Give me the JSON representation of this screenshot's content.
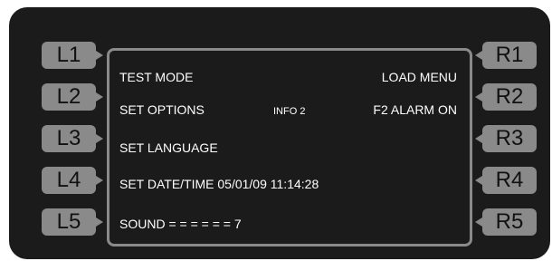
{
  "left_keys": [
    "L1",
    "L2",
    "L3",
    "L4",
    "L5"
  ],
  "right_keys": [
    "R1",
    "R2",
    "R3",
    "R4",
    "R5"
  ],
  "screen": {
    "left_labels": [
      "TEST MODE",
      "SET OPTIONS",
      "SET LANGUAGE",
      "SET DATE/TIME  05/01/09  11:14:28",
      "SOUND = = = = = = 7"
    ],
    "right_labels": [
      "LOAD MENU",
      "F2 ALARM ON"
    ],
    "center_label": "INFO 2"
  },
  "colors": {
    "bezel": "#1b1b1b",
    "key": "#8a8a8a",
    "text": "#ffffff"
  }
}
